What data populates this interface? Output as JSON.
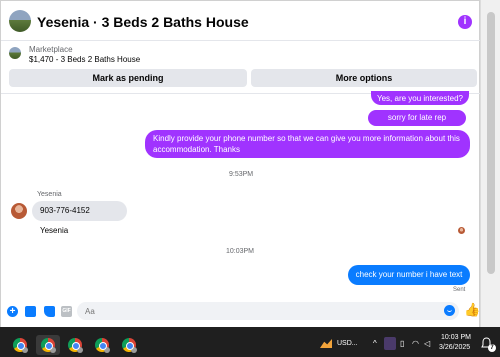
{
  "header": {
    "title": "Yesenia · 3 Beds 2 Baths House",
    "info_icon": "i"
  },
  "listing": {
    "source_label": "Marketplace",
    "price_line": "$1,470 - 3 Beds 2 Baths House",
    "pending_button": "Mark as pending",
    "more_button": "More options"
  },
  "messages": {
    "out_1": "Yes, are you interested?",
    "out_2": "sorry for late rep",
    "out_3": "Kindly provide your phone number so that we can give you more information about this accommodation. Thanks",
    "time_1": "9:53PM",
    "sender_name": "Yesenia",
    "in_1": "903-776-4152  Yesenia",
    "time_2": "10:03PM",
    "out_4": "check your number i have text",
    "sent_status": "Sent"
  },
  "composer": {
    "plus": "+",
    "gif": "GIF",
    "placeholder": "Aa",
    "like_icon": "👍"
  },
  "taskbar": {
    "stock_label": "USD...",
    "chevron": "^",
    "clock_time": "10:03 PM",
    "clock_date": "3/26/2025",
    "notification_count": "7"
  },
  "colors": {
    "outgoing_bubble": "#a033ff",
    "latest_bubble": "#0a7cff",
    "incoming_bubble": "#e4e6eb"
  }
}
